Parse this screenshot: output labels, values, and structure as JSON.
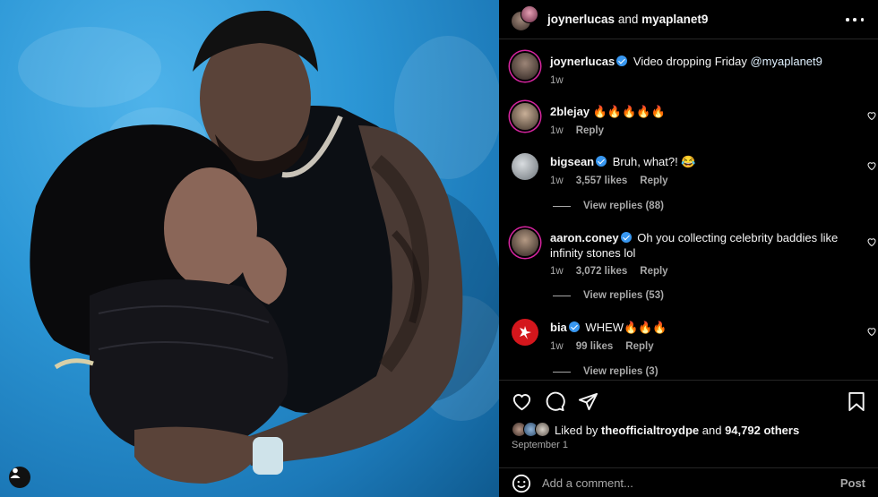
{
  "header": {
    "user1": "joynerlucas",
    "conjunction": "and",
    "user2": "myaplanet9"
  },
  "caption": {
    "user": "joynerlucas",
    "text": "Video dropping Friday",
    "mention": "@myaplanet9",
    "time": "1w"
  },
  "comments": [
    {
      "user": "2blejay",
      "verified": false,
      "text": "🔥🔥🔥🔥🔥",
      "time": "1w",
      "likes": "",
      "reply": "Reply"
    },
    {
      "user": "bigsean",
      "verified": true,
      "text": "Bruh, what?! 😂",
      "time": "1w",
      "likes": "3,557 likes",
      "reply": "Reply",
      "view_replies": "View replies (88)"
    },
    {
      "user": "aaron.coney",
      "verified": true,
      "text": "Oh you collecting celebrity baddies like infinity stones lol",
      "time": "1w",
      "likes": "3,072 likes",
      "reply": "Reply",
      "view_replies": "View replies (53)"
    },
    {
      "user": "bia",
      "verified": true,
      "text": "WHEW🔥🔥🔥",
      "time": "1w",
      "likes": "99 likes",
      "reply": "Reply",
      "view_replies": "View replies (3)"
    }
  ],
  "likes": {
    "prefix": "Liked by",
    "user": "theofficialtroydpe",
    "and": "and",
    "count": "94,792 others"
  },
  "date": "September 1",
  "add_comment": {
    "placeholder": "Add a comment...",
    "post_label": "Post"
  },
  "icons": {
    "like": "heart-icon",
    "comment": "comment-icon",
    "share": "share-icon",
    "save": "bookmark-icon",
    "more": "more-icon",
    "emoji": "emoji-icon",
    "info": "person-tag-icon"
  },
  "colors": {
    "background": "#000000",
    "verified": "#3897f0",
    "secondary_text": "#a8a8a8",
    "sheet_blue": "#2c97d6"
  }
}
